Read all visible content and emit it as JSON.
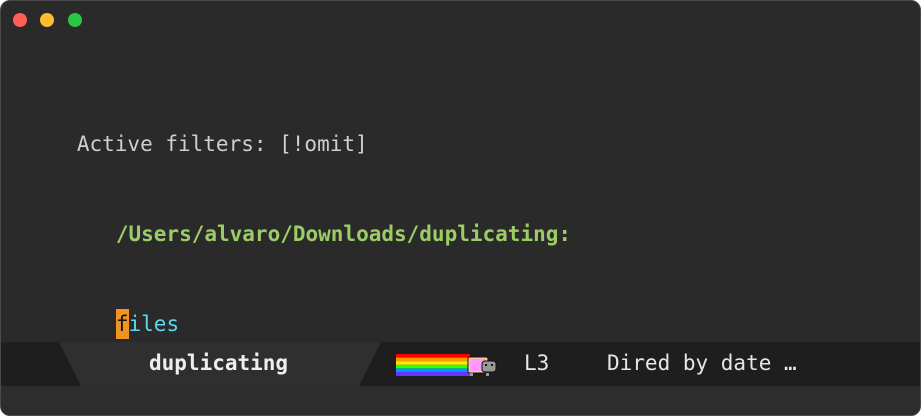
{
  "window": {
    "colors": {
      "background": "#2a2a2a",
      "close": "#ff5f57",
      "minimize": "#febc2e",
      "zoom": "#28c840"
    }
  },
  "buffer": {
    "filter_line": "Active filters: [!omit]",
    "directory_header": "/Users/alvaro/Downloads/duplicating:",
    "entry": {
      "cursor_char": "f",
      "rest": "iles"
    },
    "colors": {
      "filter_text": "#cfcfcf",
      "directory": "#9ccc65",
      "entry": "#5fd7e8",
      "cursor": "#f09320"
    }
  },
  "modeline": {
    "buffer_name": "duplicating",
    "nyan_icon": "nyan-cat-icon",
    "line_number": "L3",
    "major_mode": "Dired by date …",
    "colors": {
      "background": "#1e1e1e",
      "active_segment": "#2f2f2f"
    }
  }
}
